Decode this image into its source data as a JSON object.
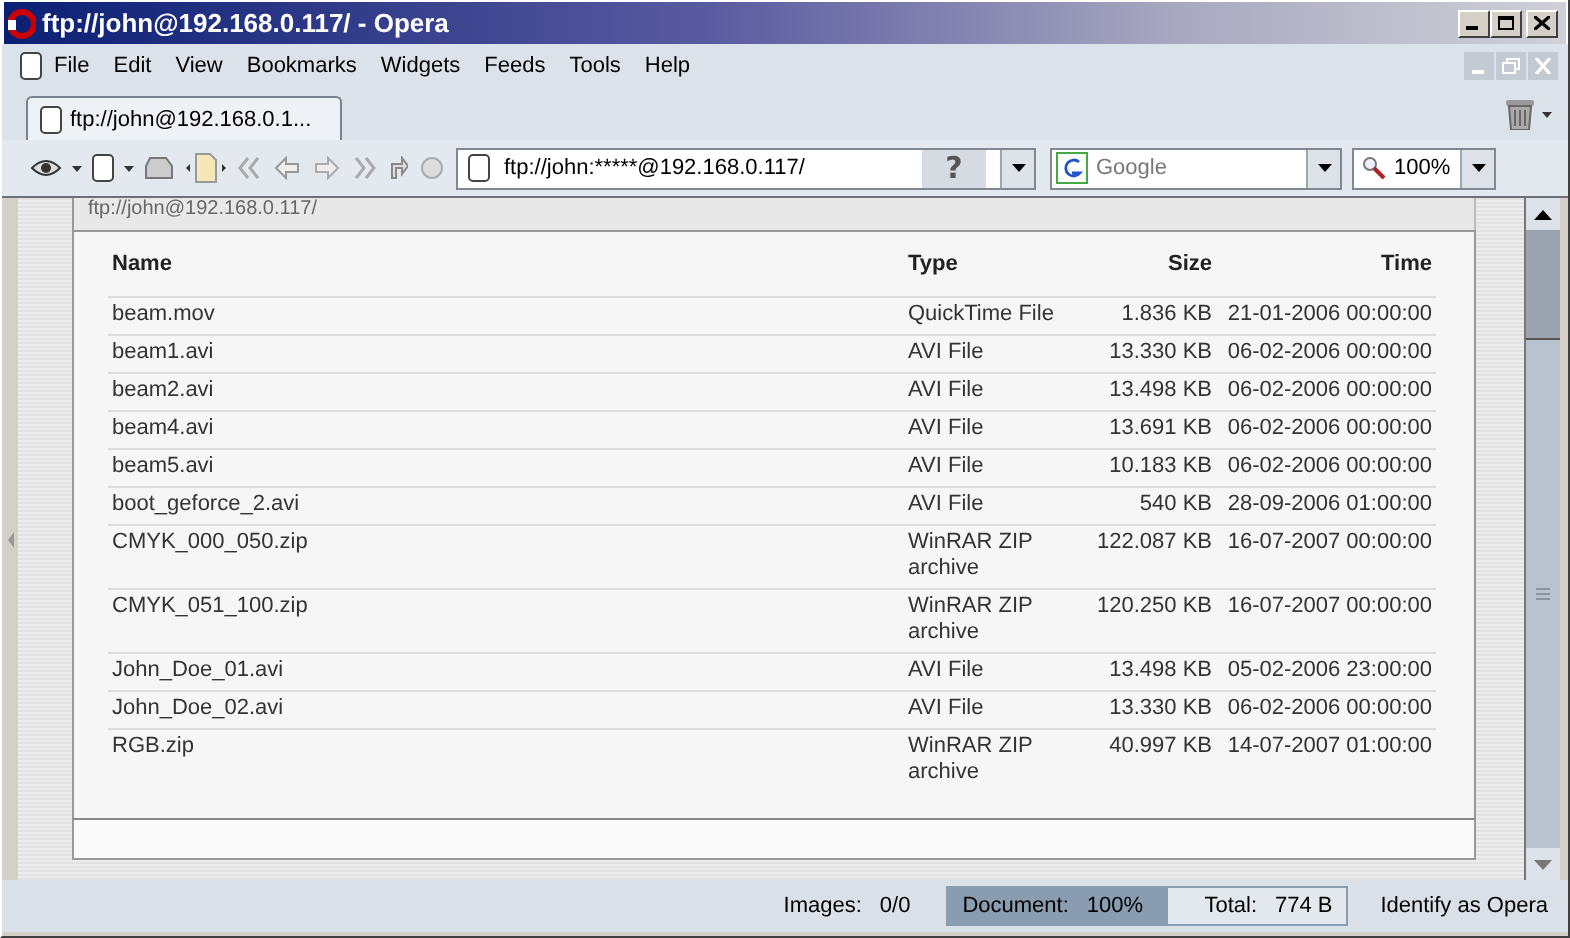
{
  "window": {
    "title": "ftp://john@192.168.0.117/ - Opera"
  },
  "menu": [
    "File",
    "Edit",
    "View",
    "Bookmarks",
    "Widgets",
    "Feeds",
    "Tools",
    "Help"
  ],
  "tabs": [
    {
      "label": "ftp://john@192.168.0.1...",
      "selected": true
    }
  ],
  "address": {
    "value": "ftp://john:*****@192.168.0.117/",
    "help": "?"
  },
  "search": {
    "placeholder": "Google"
  },
  "zoom": {
    "value": "100%"
  },
  "page": {
    "heading": "ftp://john@192.168.0.117/",
    "columns": [
      "Name",
      "Type",
      "Size",
      "Time"
    ],
    "rows": [
      [
        "beam.mov",
        "QuickTime File",
        "1.836 KB",
        "21-01-2006 00:00:00"
      ],
      [
        "beam1.avi",
        "AVI File",
        "13.330 KB",
        "06-02-2006 00:00:00"
      ],
      [
        "beam2.avi",
        "AVI File",
        "13.498 KB",
        "06-02-2006 00:00:00"
      ],
      [
        "beam4.avi",
        "AVI File",
        "13.691 KB",
        "06-02-2006 00:00:00"
      ],
      [
        "beam5.avi",
        "AVI File",
        "10.183 KB",
        "06-02-2006 00:00:00"
      ],
      [
        "boot_geforce_2.avi",
        "AVI File",
        "540 KB",
        "28-09-2006 01:00:00"
      ],
      [
        "CMYK_000_050.zip",
        "WinRAR ZIP archive",
        "122.087 KB",
        "16-07-2007 00:00:00"
      ],
      [
        "CMYK_051_100.zip",
        "WinRAR ZIP archive",
        "120.250 KB",
        "16-07-2007 00:00:00"
      ],
      [
        "John_Doe_01.avi",
        "AVI File",
        "13.498 KB",
        "05-02-2006 23:00:00"
      ],
      [
        "John_Doe_02.avi",
        "AVI File",
        "13.330 KB",
        "06-02-2006 00:00:00"
      ],
      [
        "RGB.zip",
        "WinRAR ZIP archive",
        "40.997 KB",
        "14-07-2007 01:00:00"
      ]
    ]
  },
  "status_bar": [
    {
      "kind": "plain",
      "label": "Images:",
      "value": "0/0"
    },
    {
      "kind": "progress",
      "label": "Document:",
      "value": "100%",
      "level": 1
    },
    {
      "kind": "boxed",
      "label": "Total:",
      "value": "774 B"
    },
    {
      "kind": "button",
      "label": "Identify as Opera"
    }
  ]
}
